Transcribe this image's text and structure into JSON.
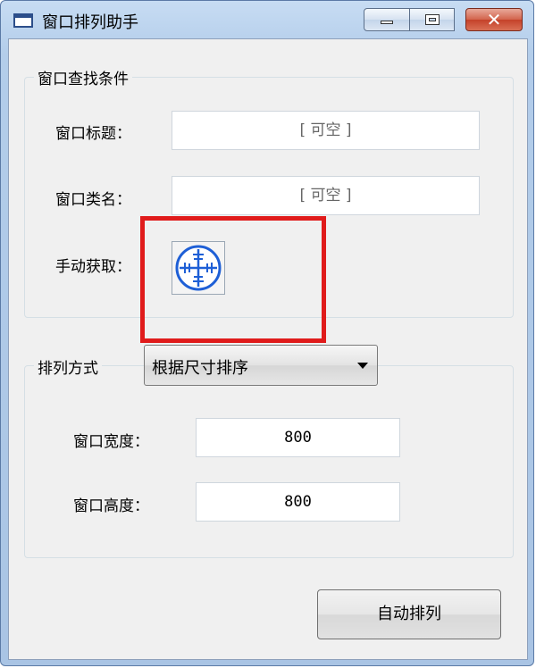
{
  "window": {
    "title": "窗口排列助手",
    "controls": {
      "minimize_icon": "minimize-icon",
      "maximize_icon": "maximize-icon",
      "close_icon": "close-icon"
    }
  },
  "search": {
    "group_title": "窗口查找条件",
    "title_label": "窗口标题：",
    "title_value": "[ 可空 ]",
    "class_label": "窗口类名：",
    "class_value": "[ 可空 ]",
    "manual_label": "手动获取：",
    "picker_icon": "crosshair-target-icon"
  },
  "arrange": {
    "group_title": "排列方式",
    "mode_selected": "根据尺寸排序",
    "width_label": "窗口宽度：",
    "width_value": "800",
    "height_label": "窗口高度：",
    "height_value": "800"
  },
  "actions": {
    "auto_arrange_label": "自动排列"
  },
  "colors": {
    "highlight": "#e01b1b",
    "picker_blue": "#1e5fd6"
  }
}
